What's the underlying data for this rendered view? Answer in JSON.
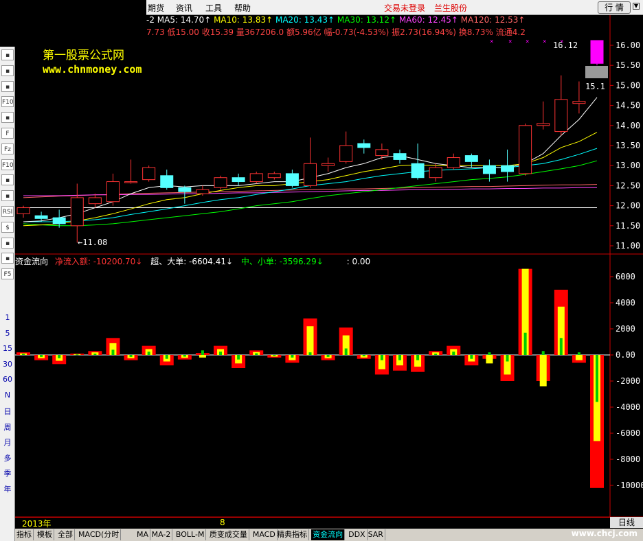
{
  "menu": {
    "items": [
      "期货",
      "资讯",
      "工具",
      "帮助"
    ],
    "status": [
      "交易未登录",
      "兰生股份"
    ],
    "quote_button": "行 情"
  },
  "info": {
    "ma_line": [
      {
        "label": "-2",
        "color": "#ffffff"
      },
      {
        "label": "MA5: 14.70↑",
        "color": "#ffffff"
      },
      {
        "label": "MA10: 13.83↑",
        "color": "#ffff00"
      },
      {
        "label": "MA20: 13.43↑",
        "color": "#00ffff"
      },
      {
        "label": "MA30: 13.12↑",
        "color": "#00ff00"
      },
      {
        "label": "MA60: 12.45↑",
        "color": "#ff44ff"
      },
      {
        "label": "MA120: 12.53↑",
        "color": "#ff6666"
      }
    ],
    "quote_line": "7.73 低15.00 收15.39 量367206.0 额5.96亿 幅-0.73(-4.53%) 振2.73(16.94%) 换8.73% 流通4.2"
  },
  "watermark": {
    "title": "第一股票公式网",
    "url": "www.chnmoney.com"
  },
  "left_tools": {
    "icons": [
      "chart-line-icon",
      "candle-icon",
      "list-icon",
      "f10-icon",
      "doc-icon",
      "f-icon",
      "fz-icon",
      "f10b-icon",
      "magnify-icon",
      "wave-icon",
      "rsi-icon",
      "dollar-icon",
      "move-icon",
      "pencil-icon",
      "f5-icon"
    ],
    "icon_labels": [
      "",
      "",
      "",
      "F10",
      "",
      "F",
      "Fz",
      "F10",
      "",
      "",
      "RSI",
      "$",
      "",
      "",
      "F5"
    ],
    "periods": [
      "1",
      "5",
      "15",
      "30",
      "60",
      "N",
      "日",
      "周",
      "月",
      "多",
      "季",
      "年"
    ]
  },
  "main_chart": {
    "y_ticks": [
      "16.00",
      "15.50",
      "15.00",
      "14.50",
      "14.00",
      "13.50",
      "13.00",
      "12.50",
      "12.00",
      "11.50",
      "11.00"
    ],
    "y_values": [
      16.0,
      15.5,
      15.0,
      14.5,
      14.0,
      13.5,
      13.0,
      12.5,
      12.0,
      11.5,
      11.0
    ],
    "high_label": "16.12",
    "high_right_label": "15.1",
    "low_label": "11.08",
    "candles": [
      {
        "o": 11.8,
        "c": 11.95,
        "h": 12.0,
        "l": 11.7
      },
      {
        "o": 11.75,
        "c": 11.68,
        "h": 11.85,
        "l": 11.6
      },
      {
        "o": 11.7,
        "c": 11.55,
        "h": 11.9,
        "l": 11.45
      },
      {
        "o": 11.5,
        "c": 12.2,
        "h": 12.55,
        "l": 11.08
      },
      {
        "o": 12.05,
        "c": 12.2,
        "h": 12.3,
        "l": 11.95
      },
      {
        "o": 12.1,
        "c": 12.6,
        "h": 12.8,
        "l": 12.0
      },
      {
        "o": 12.6,
        "c": 12.6,
        "h": 13.15,
        "l": 12.55
      },
      {
        "o": 12.65,
        "c": 12.95,
        "h": 13.0,
        "l": 12.6
      },
      {
        "o": 12.75,
        "c": 12.45,
        "h": 12.9,
        "l": 12.4
      },
      {
        "o": 12.45,
        "c": 12.35,
        "h": 12.5,
        "l": 12.05
      },
      {
        "o": 12.3,
        "c": 12.4,
        "h": 12.5,
        "l": 12.25
      },
      {
        "o": 12.45,
        "c": 12.7,
        "h": 12.75,
        "l": 12.4
      },
      {
        "o": 12.7,
        "c": 12.6,
        "h": 12.8,
        "l": 12.5
      },
      {
        "o": 12.6,
        "c": 12.8,
        "h": 12.85,
        "l": 12.55
      },
      {
        "o": 12.7,
        "c": 12.8,
        "h": 12.85,
        "l": 12.65
      },
      {
        "o": 12.8,
        "c": 12.5,
        "h": 12.9,
        "l": 12.45
      },
      {
        "o": 12.5,
        "c": 13.05,
        "h": 13.7,
        "l": 12.45
      },
      {
        "o": 13.0,
        "c": 13.05,
        "h": 13.2,
        "l": 12.85
      },
      {
        "o": 13.1,
        "c": 13.5,
        "h": 13.85,
        "l": 13.05
      },
      {
        "o": 13.55,
        "c": 13.45,
        "h": 13.65,
        "l": 13.3
      },
      {
        "o": 13.25,
        "c": 13.4,
        "h": 13.55,
        "l": 13.15
      },
      {
        "o": 13.3,
        "c": 13.15,
        "h": 13.4,
        "l": 13.05
      },
      {
        "o": 13.05,
        "c": 12.7,
        "h": 13.55,
        "l": 12.65
      },
      {
        "o": 12.7,
        "c": 12.95,
        "h": 13.05,
        "l": 12.6
      },
      {
        "o": 12.95,
        "c": 13.2,
        "h": 13.3,
        "l": 12.9
      },
      {
        "o": 13.25,
        "c": 13.1,
        "h": 13.3,
        "l": 12.95
      },
      {
        "o": 13.0,
        "c": 12.8,
        "h": 13.15,
        "l": 12.6
      },
      {
        "o": 13.0,
        "c": 12.85,
        "h": 13.4,
        "l": 12.6
      },
      {
        "o": 12.8,
        "c": 14.0,
        "h": 14.05,
        "l": 12.75
      },
      {
        "o": 14.0,
        "c": 14.05,
        "h": 14.6,
        "l": 13.9
      },
      {
        "o": 13.85,
        "c": 14.65,
        "h": 15.25,
        "l": 13.75
      },
      {
        "o": 14.55,
        "c": 14.6,
        "h": 15.1,
        "l": 14.3
      },
      {
        "o": 15.55,
        "c": 16.12,
        "h": 16.12,
        "l": 15.5
      }
    ],
    "ma5": [
      11.6,
      11.62,
      11.7,
      11.8,
      11.95,
      12.1,
      12.3,
      12.45,
      12.5,
      12.47,
      12.5,
      12.5,
      12.5,
      12.55,
      12.6,
      12.6,
      12.7,
      12.8,
      12.95,
      13.05,
      13.2,
      13.25,
      13.15,
      13.05,
      13.0,
      12.95,
      12.95,
      12.95,
      13.05,
      13.3,
      13.75,
      14.15,
      14.7
    ],
    "ma10": [
      11.5,
      11.52,
      11.55,
      11.62,
      11.7,
      11.8,
      11.92,
      12.05,
      12.15,
      12.2,
      12.3,
      12.38,
      12.45,
      12.5,
      12.5,
      12.55,
      12.6,
      12.65,
      12.75,
      12.85,
      12.92,
      13.0,
      13.02,
      13.0,
      13.0,
      13.0,
      13.0,
      13.0,
      13.05,
      13.2,
      13.45,
      13.6,
      13.83
    ],
    "ma20": [
      11.6,
      11.6,
      11.6,
      11.62,
      11.65,
      11.7,
      11.78,
      11.85,
      11.92,
      12.0,
      12.08,
      12.15,
      12.2,
      12.28,
      12.35,
      12.42,
      12.5,
      12.55,
      12.6,
      12.68,
      12.75,
      12.8,
      12.85,
      12.88,
      12.9,
      12.92,
      12.95,
      12.95,
      13.0,
      13.05,
      13.15,
      13.28,
      13.43
    ],
    "ma30": [
      11.55,
      11.52,
      11.5,
      11.5,
      11.52,
      11.55,
      11.6,
      11.65,
      11.7,
      11.75,
      11.8,
      11.85,
      11.92,
      12.0,
      12.05,
      12.1,
      12.18,
      12.25,
      12.3,
      12.35,
      12.4,
      12.45,
      12.5,
      12.55,
      12.6,
      12.65,
      12.68,
      12.72,
      12.78,
      12.85,
      12.92,
      13.0,
      13.12
    ],
    "ma60": [
      12.25,
      12.25,
      12.25,
      12.26,
      12.27,
      12.27,
      12.28,
      12.28,
      12.29,
      12.3,
      12.3,
      12.31,
      12.32,
      12.32,
      12.33,
      12.34,
      12.35,
      12.36,
      12.37,
      12.38,
      12.38,
      12.39,
      12.4,
      12.4,
      12.41,
      12.42,
      12.42,
      12.43,
      12.43,
      12.44,
      12.44,
      12.45,
      12.45
    ],
    "ma120": [
      12.2,
      12.22,
      12.24,
      12.25,
      12.27,
      12.28,
      12.3,
      12.31,
      12.32,
      12.33,
      12.34,
      12.35,
      12.36,
      12.37,
      12.38,
      12.39,
      12.4,
      12.41,
      12.42,
      12.42,
      12.43,
      12.44,
      12.45,
      12.46,
      12.47,
      12.48,
      12.48,
      12.49,
      12.5,
      12.51,
      12.52,
      12.52,
      12.53
    ],
    "ma250": [
      11.95,
      11.95,
      11.95,
      11.95,
      11.95,
      11.95,
      11.95,
      11.95,
      11.95,
      11.95,
      11.95,
      11.95,
      11.95,
      11.95,
      11.95,
      11.95,
      11.95,
      11.95,
      11.95,
      11.95,
      11.95,
      11.95,
      11.95,
      11.95,
      11.95,
      11.95,
      11.95,
      11.95,
      11.95,
      11.95,
      11.95,
      11.95,
      11.95
    ]
  },
  "flow": {
    "title": "资金流向",
    "net_label": "净流入额: -10200.70↓",
    "big_label": "超、大单: -6604.41↓",
    "small_label": "中、小单: -3596.29↓",
    "zero_label": ": 0.00"
  },
  "flow_chart": {
    "y_ticks": [
      "6000",
      "4000",
      "2000",
      "0.00",
      "-2000",
      "-4000",
      "-6000",
      "-8000",
      "-10000"
    ],
    "y_values": [
      6000,
      4000,
      2000,
      0,
      -2000,
      -4000,
      -6000,
      -8000,
      -10000
    ],
    "bars": [
      {
        "net": 200,
        "big": 120,
        "small": 80
      },
      {
        "net": -400,
        "big": -250,
        "small": -150
      },
      {
        "net": -700,
        "big": -450,
        "small": -250
      },
      {
        "net": 100,
        "big": 60,
        "small": 40
      },
      {
        "net": 300,
        "big": 200,
        "small": 100
      },
      {
        "net": 1300,
        "big": 900,
        "small": 400
      },
      {
        "net": -400,
        "big": -250,
        "small": -150
      },
      {
        "net": 700,
        "big": 450,
        "small": 250
      },
      {
        "net": -800,
        "big": -500,
        "small": -300
      },
      {
        "net": -350,
        "big": -220,
        "small": -130
      },
      {
        "net": 150,
        "big": -200,
        "small": 350
      },
      {
        "net": 700,
        "big": 450,
        "small": 250
      },
      {
        "net": -1000,
        "big": -650,
        "small": -350
      },
      {
        "net": 350,
        "big": 220,
        "small": 130
      },
      {
        "net": -200,
        "big": -130,
        "small": -70
      },
      {
        "net": -600,
        "big": -400,
        "small": -200
      },
      {
        "net": 2800,
        "big": 2200,
        "small": 200
      },
      {
        "net": -400,
        "big": -250,
        "small": -150
      },
      {
        "net": 2100,
        "big": 1500,
        "small": 500
      },
      {
        "net": -300,
        "big": -200,
        "small": -100
      },
      {
        "net": -1500,
        "big": -1100,
        "small": -400
      },
      {
        "net": -1200,
        "big": -800,
        "small": -400
      },
      {
        "net": -1300,
        "big": -900,
        "small": -400
      },
      {
        "net": 300,
        "big": 200,
        "small": 100
      },
      {
        "net": 700,
        "big": 450,
        "small": 250
      },
      {
        "net": -800,
        "big": -500,
        "small": -300
      },
      {
        "net": -300,
        "big": -650,
        "small": 200
      },
      {
        "net": -2000,
        "big": -1500,
        "small": -500
      },
      {
        "net": 6600,
        "big": 6600,
        "small": 1700
      },
      {
        "net": -2000,
        "big": -2400,
        "small": 300
      },
      {
        "net": 5000,
        "big": 3700,
        "small": 1300
      },
      {
        "net": -600,
        "big": -400,
        "small": 200
      },
      {
        "net": -10200,
        "big": -6600,
        "small": -3600
      }
    ]
  },
  "timeline": {
    "year": "2013年",
    "month": "8"
  },
  "day_button": "日线",
  "tabs": [
    "指标",
    "模板",
    "全部",
    "MACD(分时",
    "MA",
    "MA-2",
    "BOLL-M",
    "质变成交量",
    "MACD",
    "精典指标",
    "资金流向",
    "DDX",
    "SAR"
  ],
  "active_tab": "资金流向",
  "footer_logo": "www.chcj.com"
}
